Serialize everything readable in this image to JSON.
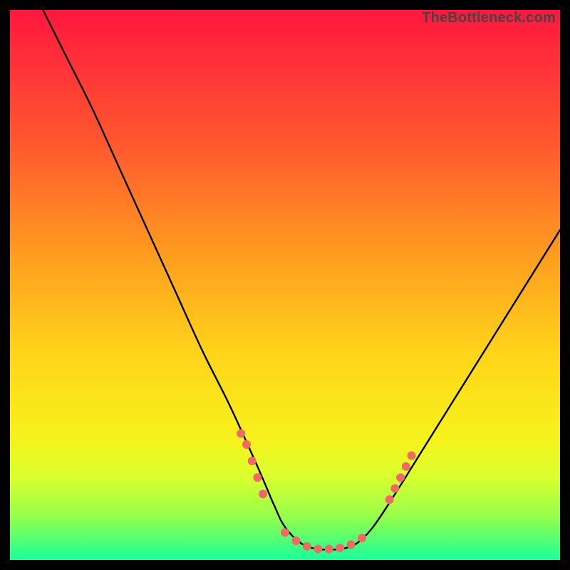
{
  "watermark": "TheBottleneck.com",
  "chart_data": {
    "type": "line",
    "title": "",
    "xlabel": "",
    "ylabel": "",
    "xlim": [
      0,
      100
    ],
    "ylim": [
      0,
      100
    ],
    "grid": false,
    "legend": false,
    "gradient_stops": [
      {
        "offset": 0,
        "color": "#ff173f"
      },
      {
        "offset": 0.25,
        "color": "#ff5a2e"
      },
      {
        "offset": 0.45,
        "color": "#ff9e1f"
      },
      {
        "offset": 0.62,
        "color": "#ffd31a"
      },
      {
        "offset": 0.78,
        "color": "#f7f21b"
      },
      {
        "offset": 0.85,
        "color": "#d9ff2e"
      },
      {
        "offset": 0.92,
        "color": "#97ff4a"
      },
      {
        "offset": 0.97,
        "color": "#49ff7b"
      },
      {
        "offset": 1.0,
        "color": "#18ff9b"
      }
    ],
    "series": [
      {
        "name": "bottleneck-curve",
        "x": [
          6,
          10,
          15,
          20,
          25,
          30,
          35,
          40,
          45,
          48,
          50,
          53,
          56,
          60,
          63,
          66,
          70,
          75,
          80,
          85,
          90,
          95,
          100
        ],
        "y": [
          100,
          92,
          82,
          71,
          60,
          49,
          38,
          28,
          17,
          10,
          6,
          3,
          2,
          2,
          3,
          6,
          12,
          20,
          28,
          36,
          44,
          52,
          60
        ]
      }
    ],
    "markers": {
      "name": "highlight-points",
      "color": "#ef6a63",
      "radius": 6,
      "points": [
        {
          "x": 42,
          "y": 23
        },
        {
          "x": 43,
          "y": 21
        },
        {
          "x": 44,
          "y": 18
        },
        {
          "x": 45,
          "y": 15
        },
        {
          "x": 46,
          "y": 12
        },
        {
          "x": 50,
          "y": 5
        },
        {
          "x": 52,
          "y": 3.5
        },
        {
          "x": 54,
          "y": 2.5
        },
        {
          "x": 56,
          "y": 2
        },
        {
          "x": 58,
          "y": 2
        },
        {
          "x": 60,
          "y": 2.2
        },
        {
          "x": 62,
          "y": 2.8
        },
        {
          "x": 64,
          "y": 4
        },
        {
          "x": 69,
          "y": 11
        },
        {
          "x": 70,
          "y": 13
        },
        {
          "x": 71,
          "y": 15
        },
        {
          "x": 72,
          "y": 17
        },
        {
          "x": 73,
          "y": 19
        }
      ]
    }
  }
}
